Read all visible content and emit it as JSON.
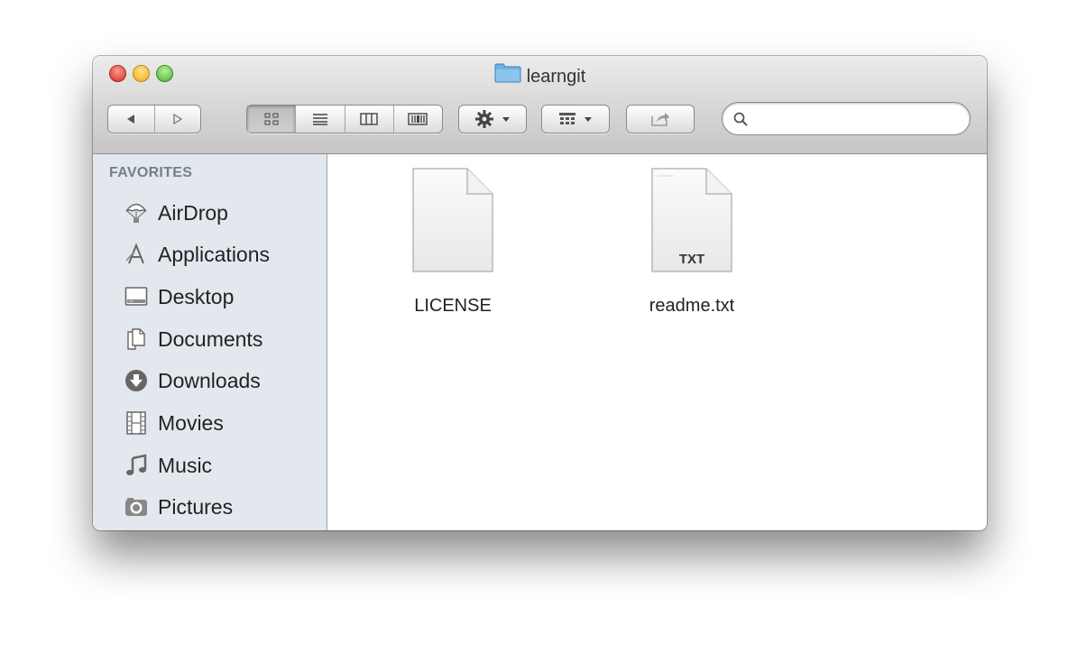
{
  "window": {
    "title": "learngit",
    "folder_icon": "folder-icon"
  },
  "toolbar": {
    "nav": {
      "back_icon": "back-arrow-icon",
      "forward_icon": "forward-arrow-icon"
    },
    "views": [
      {
        "name": "icon-view",
        "icon": "grid-icon",
        "active": true
      },
      {
        "name": "list-view",
        "icon": "list-icon",
        "active": false
      },
      {
        "name": "column-view",
        "icon": "columns-icon",
        "active": false
      },
      {
        "name": "cover-flow-view",
        "icon": "coverflow-icon",
        "active": false
      }
    ],
    "action_icon": "gear-icon",
    "arrange_icon": "arrange-icon",
    "share_icon": "share-icon",
    "search": {
      "placeholder": "",
      "value": ""
    }
  },
  "sidebar": {
    "heading": "FAVORITES",
    "items": [
      {
        "label": "AirDrop",
        "icon": "airdrop-icon"
      },
      {
        "label": "Applications",
        "icon": "applications-icon"
      },
      {
        "label": "Desktop",
        "icon": "desktop-icon"
      },
      {
        "label": "Documents",
        "icon": "documents-icon"
      },
      {
        "label": "Downloads",
        "icon": "downloads-icon"
      },
      {
        "label": "Movies",
        "icon": "movies-icon"
      },
      {
        "label": "Music",
        "icon": "music-icon"
      },
      {
        "label": "Pictures",
        "icon": "pictures-icon"
      }
    ]
  },
  "files": [
    {
      "name": "LICENSE",
      "badge": ""
    },
    {
      "name": "readme.txt",
      "badge": "TXT"
    }
  ],
  "colors": {
    "close": "#e0453a",
    "minimize": "#f5b92b",
    "maximize": "#5fc24a",
    "sidebar_bg": "#e3e8ee",
    "folder": "#6fb1e6"
  }
}
